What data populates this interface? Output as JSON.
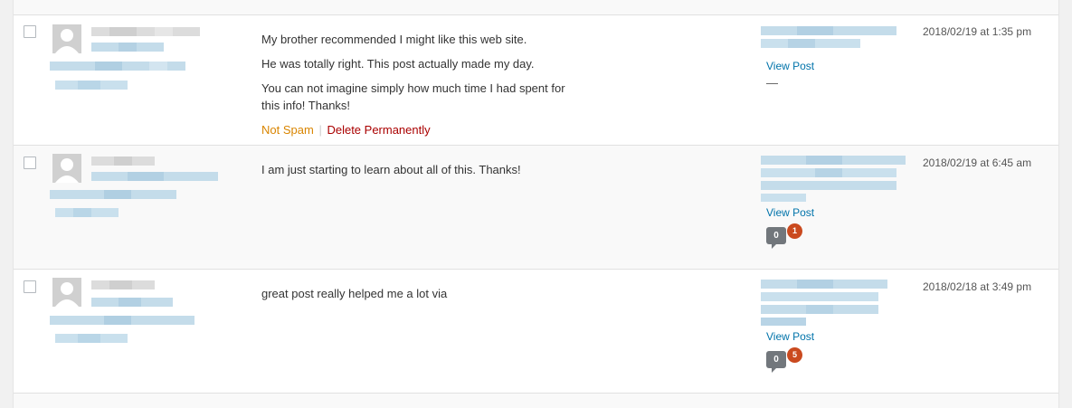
{
  "comments": [
    {
      "lines": [
        "My brother recommended I might like this web site.",
        "He was totally right. This post actually made my day.",
        "You can not imagine simply how much time I had spent for this info! Thanks!"
      ],
      "actions": {
        "not_spam": "Not Spam",
        "separator": "|",
        "delete": "Delete Permanently"
      },
      "view_post": "View Post",
      "response_dash": "—",
      "date": "2018/02/19 at 1:35 pm"
    },
    {
      "lines": [
        "I am just starting to learn about all of this. Thanks!"
      ],
      "view_post": "View Post",
      "approved_count": "0",
      "pending_count": "1",
      "date": "2018/02/19 at 6:45 am"
    },
    {
      "lines": [
        "great post really helped me a lot via"
      ],
      "view_post": "View Post",
      "approved_count": "0",
      "pending_count": "5",
      "date": "2018/02/18 at 3:49 pm"
    }
  ],
  "colors": {
    "link": "#0073aa",
    "not_spam": "#d98500",
    "delete": "#a00000",
    "pending_badge": "#ca4a1f",
    "count_bubble": "#72777c"
  },
  "icons": {
    "avatar": "default-person-avatar-icon",
    "bubble": "comment-count-bubble-icon"
  }
}
